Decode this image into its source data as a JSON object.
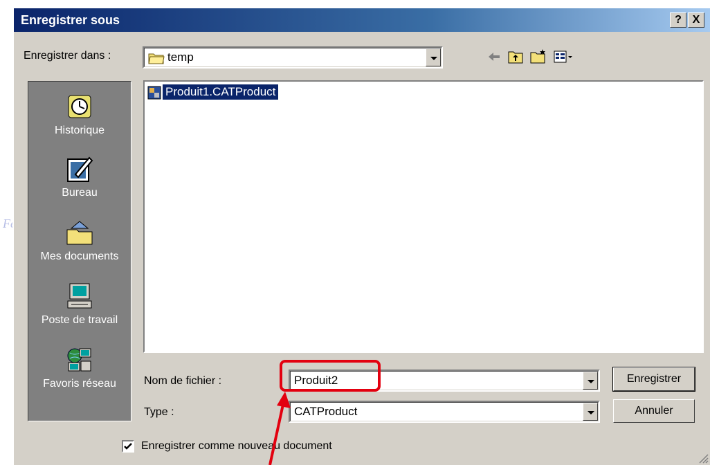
{
  "background_text": "Fe",
  "dialog": {
    "title": "Enregistrer sous",
    "help_button": "?",
    "close_button": "X"
  },
  "save_in": {
    "label": "Enregistrer dans :",
    "value": "temp"
  },
  "toolbar_icons": [
    "back-arrow-icon",
    "up-folder-icon",
    "new-folder-icon",
    "view-menu-icon"
  ],
  "places": [
    {
      "label": "Historique",
      "icon": "history-icon"
    },
    {
      "label": "Bureau",
      "icon": "desktop-icon"
    },
    {
      "label": "Mes documents",
      "icon": "my-documents-icon"
    },
    {
      "label": "Poste de travail",
      "icon": "my-computer-icon"
    },
    {
      "label": "Favoris réseau",
      "icon": "network-places-icon"
    }
  ],
  "files": [
    {
      "name": "Produit1.CATProduct",
      "selected": true,
      "icon": "catproduct-file-icon"
    }
  ],
  "filename": {
    "label": "Nom de fichier :",
    "value": "Produit2"
  },
  "type": {
    "label": "Type :",
    "value": "CATProduct"
  },
  "buttons": {
    "save": "Enregistrer",
    "cancel": "Annuler"
  },
  "checkbox": {
    "label": "Enregistrer comme nouveau document",
    "checked": true
  },
  "annotation": {
    "color": "#e3000f"
  },
  "colors": {
    "dialog_face": "#d4d0c8",
    "title_bar": "#0a246a",
    "selection": "#0a246a"
  }
}
